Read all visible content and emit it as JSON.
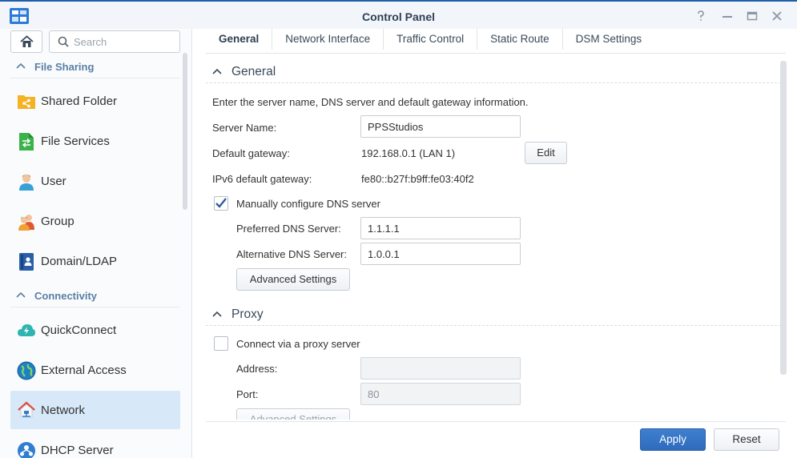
{
  "window": {
    "title": "Control Panel",
    "controls": [
      "help-icon",
      "minimize-icon",
      "maximize-icon",
      "close-icon"
    ]
  },
  "sidebar": {
    "search_placeholder": "Search",
    "sections": [
      {
        "label": "File Sharing",
        "items": [
          {
            "label": "Shared Folder",
            "icon": "shared-folder-icon"
          },
          {
            "label": "File Services",
            "icon": "file-services-icon"
          },
          {
            "label": "User",
            "icon": "user-icon"
          },
          {
            "label": "Group",
            "icon": "group-icon"
          },
          {
            "label": "Domain/LDAP",
            "icon": "domain-ldap-icon"
          }
        ]
      },
      {
        "label": "Connectivity",
        "items": [
          {
            "label": "QuickConnect",
            "icon": "quickconnect-icon"
          },
          {
            "label": "External Access",
            "icon": "external-access-icon"
          },
          {
            "label": "Network",
            "icon": "network-icon",
            "active": true
          },
          {
            "label": "DHCP Server",
            "icon": "dhcp-server-icon"
          }
        ]
      }
    ]
  },
  "tabs": [
    {
      "label": "General",
      "active": true
    },
    {
      "label": "Network Interface"
    },
    {
      "label": "Traffic Control"
    },
    {
      "label": "Static Route"
    },
    {
      "label": "DSM Settings"
    }
  ],
  "general": {
    "heading": "General",
    "description": "Enter the server name, DNS server and default gateway information.",
    "server_name_label": "Server Name:",
    "server_name_value": "PPSStudios",
    "gateway_label": "Default gateway:",
    "gateway_value": "192.168.0.1 (LAN 1)",
    "edit_label": "Edit",
    "ipv6_label": "IPv6 default gateway:",
    "ipv6_value": "fe80::b27f:b9ff:fe03:40f2",
    "dns_checkbox_label": "Manually configure DNS server",
    "dns_checked": true,
    "preferred_dns_label": "Preferred DNS Server:",
    "preferred_dns_value": "1.1.1.1",
    "alternative_dns_label": "Alternative DNS Server:",
    "alternative_dns_value": "1.0.0.1",
    "advanced_label": "Advanced Settings"
  },
  "proxy": {
    "heading": "Proxy",
    "checkbox_label": "Connect via a proxy server",
    "checked": false,
    "address_label": "Address:",
    "address_value": "",
    "port_label": "Port:",
    "port_value": "80",
    "advanced_label": "Advanced Settings"
  },
  "footer": {
    "apply_label": "Apply",
    "reset_label": "Reset"
  },
  "colors": {
    "accent": "#2f6bbd",
    "active_item_bg": "#d7e8f9",
    "section_label": "#5a7fa6"
  }
}
